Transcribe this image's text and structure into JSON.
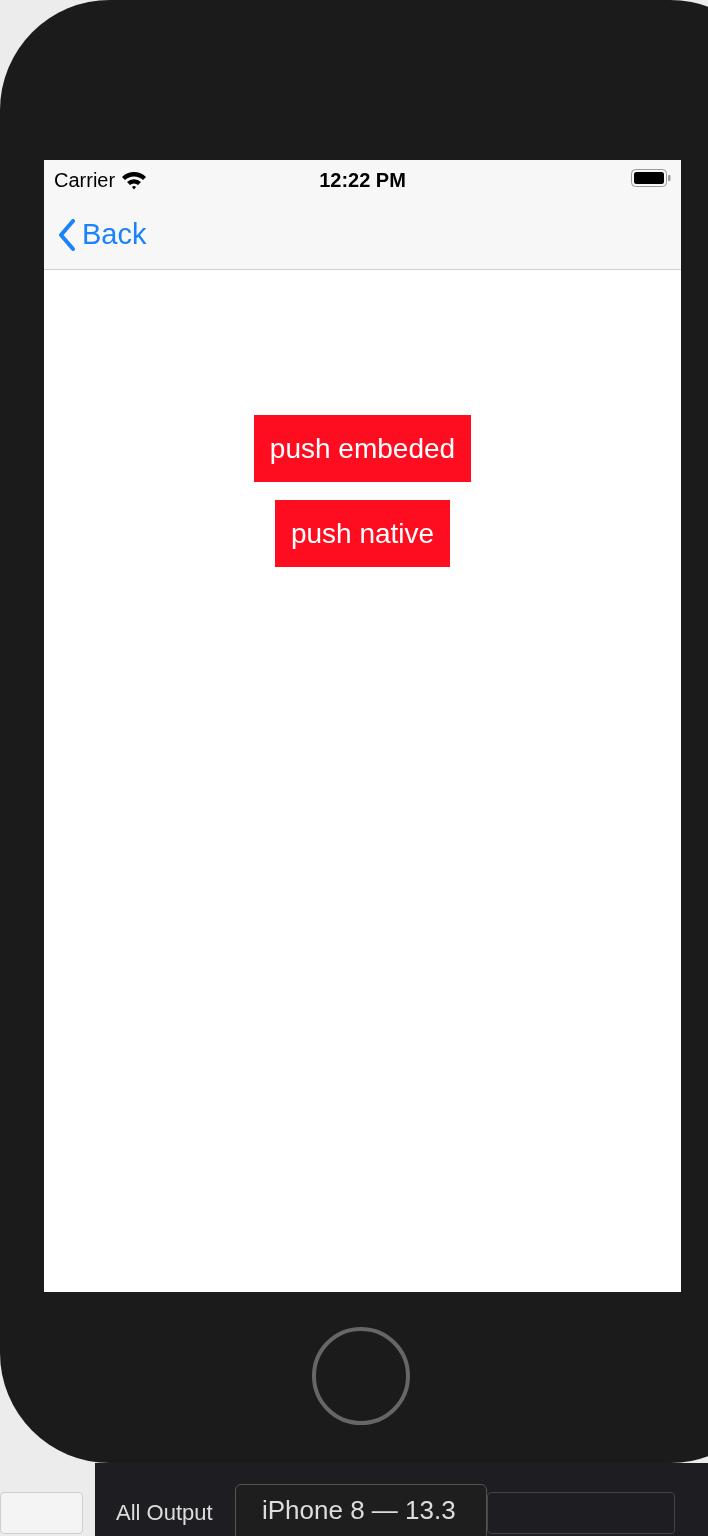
{
  "status_bar": {
    "carrier": "Carrier",
    "time": "12:22 PM"
  },
  "nav_bar": {
    "back_label": "Back"
  },
  "buttons": [
    {
      "label": "push embeded"
    },
    {
      "label": "push native"
    }
  ],
  "console": {
    "filter_label": "All Output",
    "tooltip": "iPhone 8 — 13.3"
  }
}
